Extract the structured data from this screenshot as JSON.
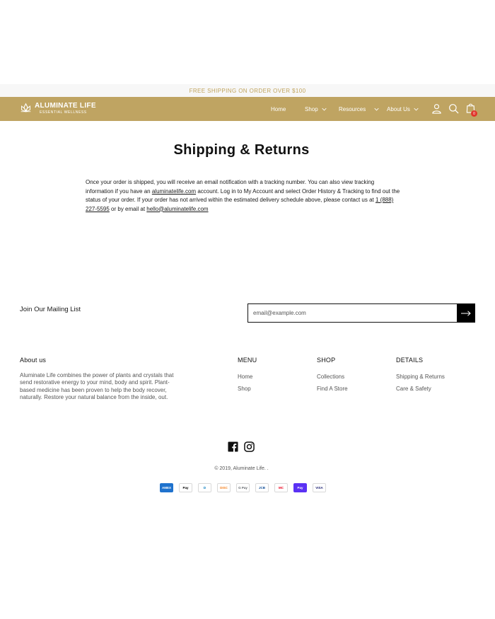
{
  "announcement": "FREE SHIPPING ON ORDER OVER $100",
  "logo": {
    "title": "ALUMINATE LIFE",
    "subtitle": "ESSENTIAL WELLNESS"
  },
  "nav": {
    "home": "Home",
    "shop": "Shop",
    "resources": "Resources",
    "about": "About Us"
  },
  "cart": {
    "count": "0"
  },
  "page": {
    "title": "Shipping & Returns",
    "body": {
      "p1": "Once your order is shipped, you will receive an email notification with a tracking number. You can also view tracking information if you have an ",
      "link1": "aluminatelife.com",
      "p2": " account. Log in to My Account and select Order History & Tracking to find out the status of your order. If your order has not arrived within the estimated delivery schedule above, please contact us at ",
      "phone": "1 (888) 227-5595",
      "p3": " or by email at ",
      "email": "hello@aluminatelife.com"
    }
  },
  "newsletter": {
    "label": "Join Our Mailing List",
    "placeholder": "email@example.com"
  },
  "footer": {
    "about_heading": "About us",
    "about_text": "Aluminate Life combines the power of plants and crystals that send restorative energy to your mind, body and spirit. Plant-based medicine has been proven to help the body recover, naturally. Restore your natural balance from the inside, out.",
    "menu_heading": "MENU",
    "menu_links": [
      "Home",
      "Shop"
    ],
    "shop_heading": "SHOP",
    "shop_links": [
      "Collections",
      "Find A Store"
    ],
    "details_heading": "DETAILS",
    "details_links": [
      "Shipping & Returns",
      "Care & Safety"
    ],
    "copyright": "© 2019, Aluminate Life. ."
  },
  "payments": [
    {
      "name": "American Express",
      "label": "AMEX",
      "color": "#1f72cd"
    },
    {
      "name": "Apple Pay",
      "label": "Pay",
      "color": "#000000"
    },
    {
      "name": "Diners Club",
      "label": "D",
      "color": "#0079be"
    },
    {
      "name": "Discover",
      "label": "DISC",
      "color": "#f58220"
    },
    {
      "name": "Google Pay",
      "label": "G Pay",
      "color": "#5f6368"
    },
    {
      "name": "JCB",
      "label": "JCB",
      "color": "#0e4c96"
    },
    {
      "name": "Mastercard",
      "label": "MC",
      "color": "#eb001b"
    },
    {
      "name": "Shop Pay",
      "label": "Pay",
      "color": "#5a31f4"
    },
    {
      "name": "Visa",
      "label": "VISA",
      "color": "#1a1f71"
    }
  ],
  "colors": {
    "brand": "#bfa462",
    "announce_text": "#c0a35c",
    "badge": "#e0352b"
  },
  "icons": [
    "account-icon",
    "search-icon",
    "cart-icon",
    "facebook-icon",
    "instagram-icon",
    "arrow-right-icon",
    "chevron-down-icon"
  ]
}
